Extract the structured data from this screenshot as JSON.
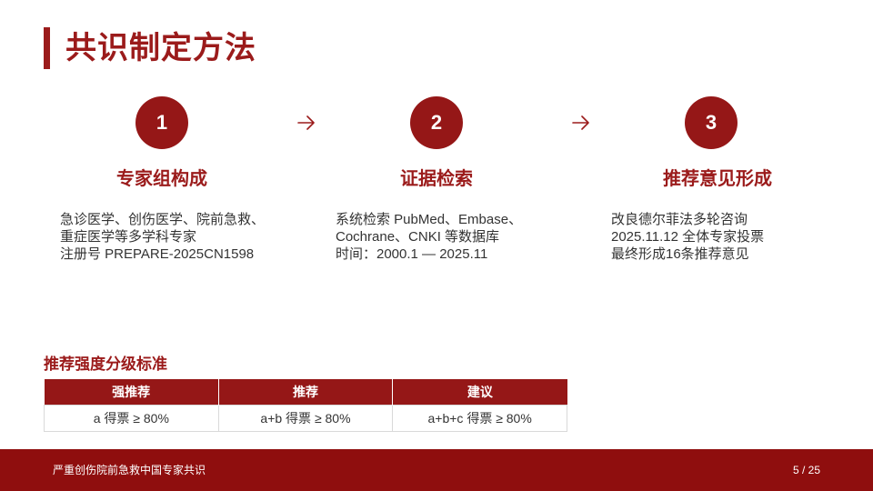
{
  "header": {
    "title": "共识制定方法"
  },
  "steps": [
    {
      "number": "1",
      "title": "专家组构成",
      "lines": [
        "急诊医学、创伤医学、院前急救、",
        "重症医学等多学科专家",
        "注册号 PREPARE-2025CN1598"
      ]
    },
    {
      "number": "2",
      "title": "证据检索",
      "lines": [
        "系统检索 PubMed、Embase、",
        "Cochrane、CNKI 等数据库",
        "时间：2000.1 — 2025.11"
      ]
    },
    {
      "number": "3",
      "title": "推荐意见形成",
      "lines": [
        "改良德尔菲法多轮咨询",
        "2025.11.12 全体专家投票",
        "最终形成16条推荐意见"
      ]
    }
  ],
  "icons": {
    "arrow": "arrow-right-icon"
  },
  "grading": {
    "title": "推荐强度分级标准",
    "headers": [
      "强推荐",
      "推荐",
      "建议"
    ],
    "row": [
      "a 得票 ≥ 80%",
      "a+b 得票 ≥ 80%",
      "a+b+c 得票 ≥ 80%"
    ]
  },
  "footer": {
    "text": "严重创伤院前急救中国专家共识",
    "page": "5 / 25"
  },
  "colors": {
    "accent": "#951717",
    "footer": "#8f0e0e"
  }
}
